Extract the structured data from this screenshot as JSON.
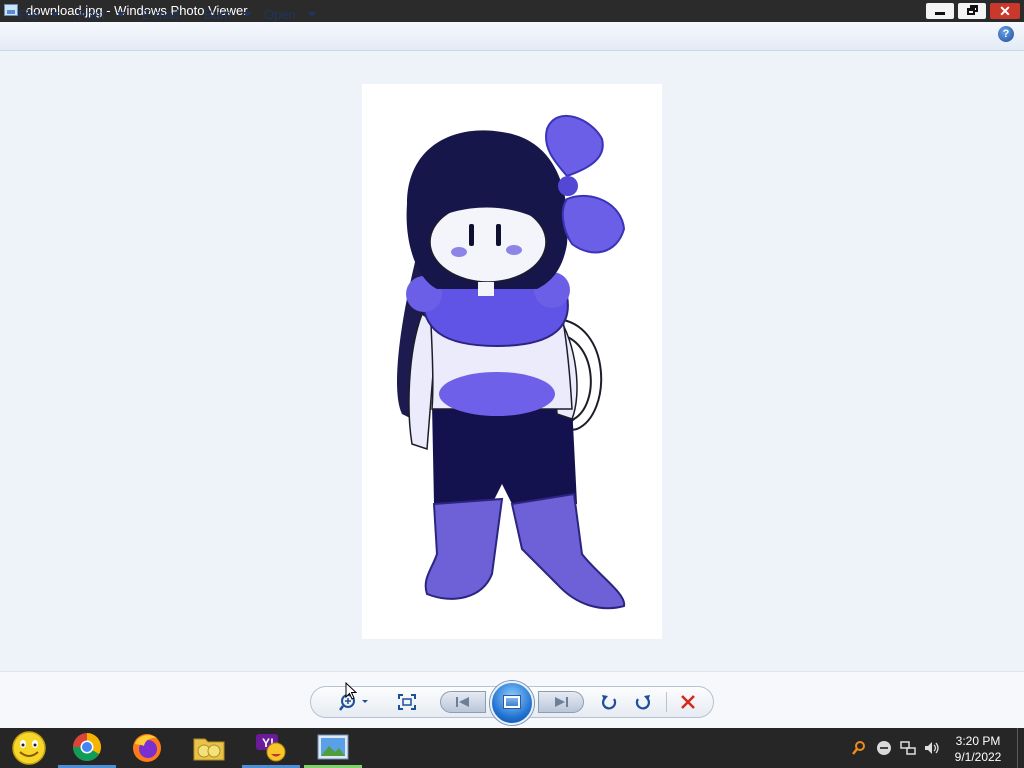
{
  "window": {
    "title": "download.jpg - Windows Photo Viewer",
    "buttons": {
      "minimize": "minimize",
      "restore": "restore",
      "close": "✕"
    }
  },
  "menubar": {
    "items": [
      {
        "label": "File",
        "has_dropdown": true
      },
      {
        "label": "Print",
        "has_dropdown": true
      },
      {
        "label": "E-mail",
        "has_dropdown": false
      },
      {
        "label": "Burn",
        "has_dropdown": true
      },
      {
        "label": "Open",
        "has_dropdown": true
      }
    ],
    "help_label": "?"
  },
  "image": {
    "subject": "purple-haired cartoon character drawing"
  },
  "controls": [
    {
      "name": "zoom-icon",
      "has_dropdown": true
    },
    {
      "name": "actual-size-icon"
    },
    {
      "name": "previous-icon"
    },
    {
      "name": "slideshow-icon"
    },
    {
      "name": "next-icon"
    },
    {
      "name": "rotate-counterclockwise-icon"
    },
    {
      "name": "rotate-clockwise-icon"
    },
    {
      "name": "delete-icon"
    }
  ],
  "taskbar": {
    "apps": [
      {
        "name": "messenger-smiley-icon"
      },
      {
        "name": "chrome-icon"
      },
      {
        "name": "firefox-icon"
      },
      {
        "name": "file-explorer-icon"
      },
      {
        "name": "yahoo-messenger-icon"
      },
      {
        "name": "photo-viewer-icon",
        "active": true
      }
    ],
    "tray": [
      "search-icon",
      "status-icon",
      "network-icon",
      "volume-icon"
    ],
    "clock": {
      "time": "3:20 PM",
      "date": "9/1/2022"
    }
  },
  "colors": {
    "titlebar": "#2b2b2b",
    "viewer_bg": "#eef3fa",
    "close_red": "#c9382b",
    "accent_blue": "#1f6fcf",
    "character_purple": "#5f54e6"
  }
}
